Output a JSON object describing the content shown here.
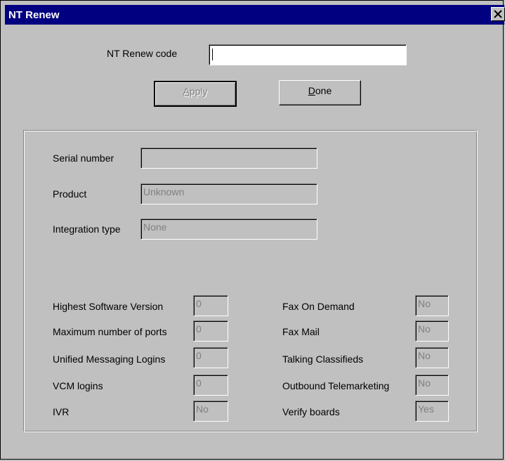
{
  "window": {
    "title": "NT Renew"
  },
  "renew": {
    "label": "NT Renew code",
    "value": ""
  },
  "buttons": {
    "apply_prefix": "",
    "apply_mnemonic": "A",
    "apply_rest": "pply",
    "done_prefix": "",
    "done_mnemonic": "D",
    "done_rest": "one"
  },
  "info": {
    "serial_label": "Serial number",
    "serial_value": "",
    "product_label": "Product",
    "product_value": "Unknown",
    "integration_label": "Integration type",
    "integration_value": "None"
  },
  "left": [
    {
      "label": "Highest Software Version",
      "value": "0"
    },
    {
      "label": "Maximum number of ports",
      "value": "0"
    },
    {
      "label": "Unified Messaging Logins",
      "value": "0"
    },
    {
      "label": "VCM logins",
      "value": "0"
    },
    {
      "label": "IVR",
      "value": "No"
    }
  ],
  "right": [
    {
      "label": "Fax On Demand",
      "value": "No"
    },
    {
      "label": "Fax Mail",
      "value": "No"
    },
    {
      "label": "Talking Classifieds",
      "value": "No"
    },
    {
      "label": "Outbound Telemarketing",
      "value": "No"
    },
    {
      "label": "Verify boards",
      "value": "Yes"
    }
  ]
}
